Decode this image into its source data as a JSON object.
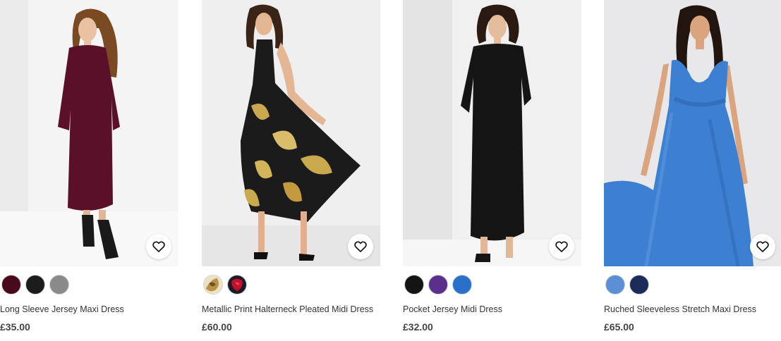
{
  "products": [
    {
      "name": "Long Sleeve Jersey Maxi Dress",
      "price": "£35.00",
      "dress_color": "#5a1028",
      "swatches": [
        "#4a0a1e",
        "#1c1c1c",
        "#8a8a8a"
      ]
    },
    {
      "name": "Metallic Print Halterneck Pleated Midi Dress",
      "price": "£60.00",
      "dress_color": "#1b1b1b",
      "swatches": [
        "#c9b06a",
        "#c0102a"
      ]
    },
    {
      "name": "Pocket Jersey Midi Dress",
      "price": "£32.00",
      "dress_color": "#151515",
      "swatches": [
        "#141414",
        "#5b2f8c",
        "#2a6fc9"
      ]
    },
    {
      "name": "Ruched Sleeveless Stretch Maxi Dress",
      "price": "£65.00",
      "dress_color": "#3d7fd1",
      "swatches": [
        "#5b8fd6",
        "#1c2b5a"
      ]
    }
  ],
  "icons": {
    "wishlist": "heart-icon"
  }
}
